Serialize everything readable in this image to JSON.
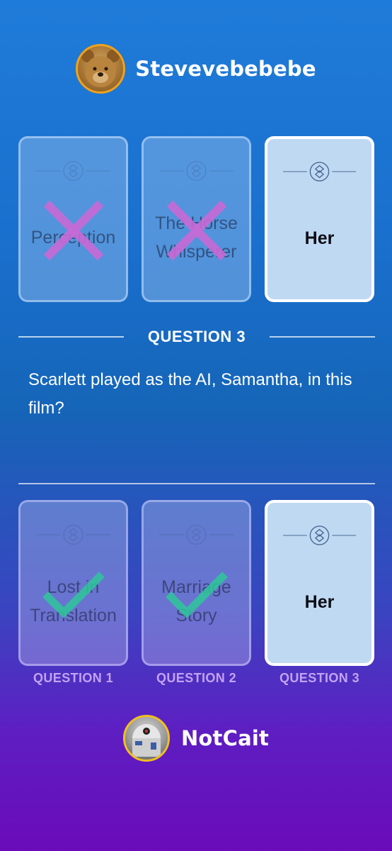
{
  "opponent": {
    "name": "Stevevebebebe",
    "avatar_icon": "teddy-bear-avatar"
  },
  "player": {
    "name": "NotCait",
    "avatar_icon": "robot-avatar"
  },
  "opponent_cards": [
    {
      "title": "Perception",
      "result": "wrong"
    },
    {
      "title": "The Horse Whisperer",
      "result": "wrong"
    },
    {
      "title": "Her",
      "result": "current"
    }
  ],
  "question": {
    "label": "QUESTION 3",
    "text": "Scarlett played as the AI, Samantha, in this film?"
  },
  "player_cards": [
    {
      "title": "Lost in Translation",
      "result": "correct",
      "caption": "QUESTION 1"
    },
    {
      "title": "Marriage Story",
      "result": "correct",
      "caption": "QUESTION 2"
    },
    {
      "title": "Her",
      "result": "current",
      "caption": "QUESTION 3"
    }
  ],
  "colors": {
    "wrong_mark": "#c86ad6",
    "correct_mark": "#2ec79a",
    "avatar_ring_top": "#f0a21a",
    "avatar_ring_bottom": "#f0c020"
  }
}
